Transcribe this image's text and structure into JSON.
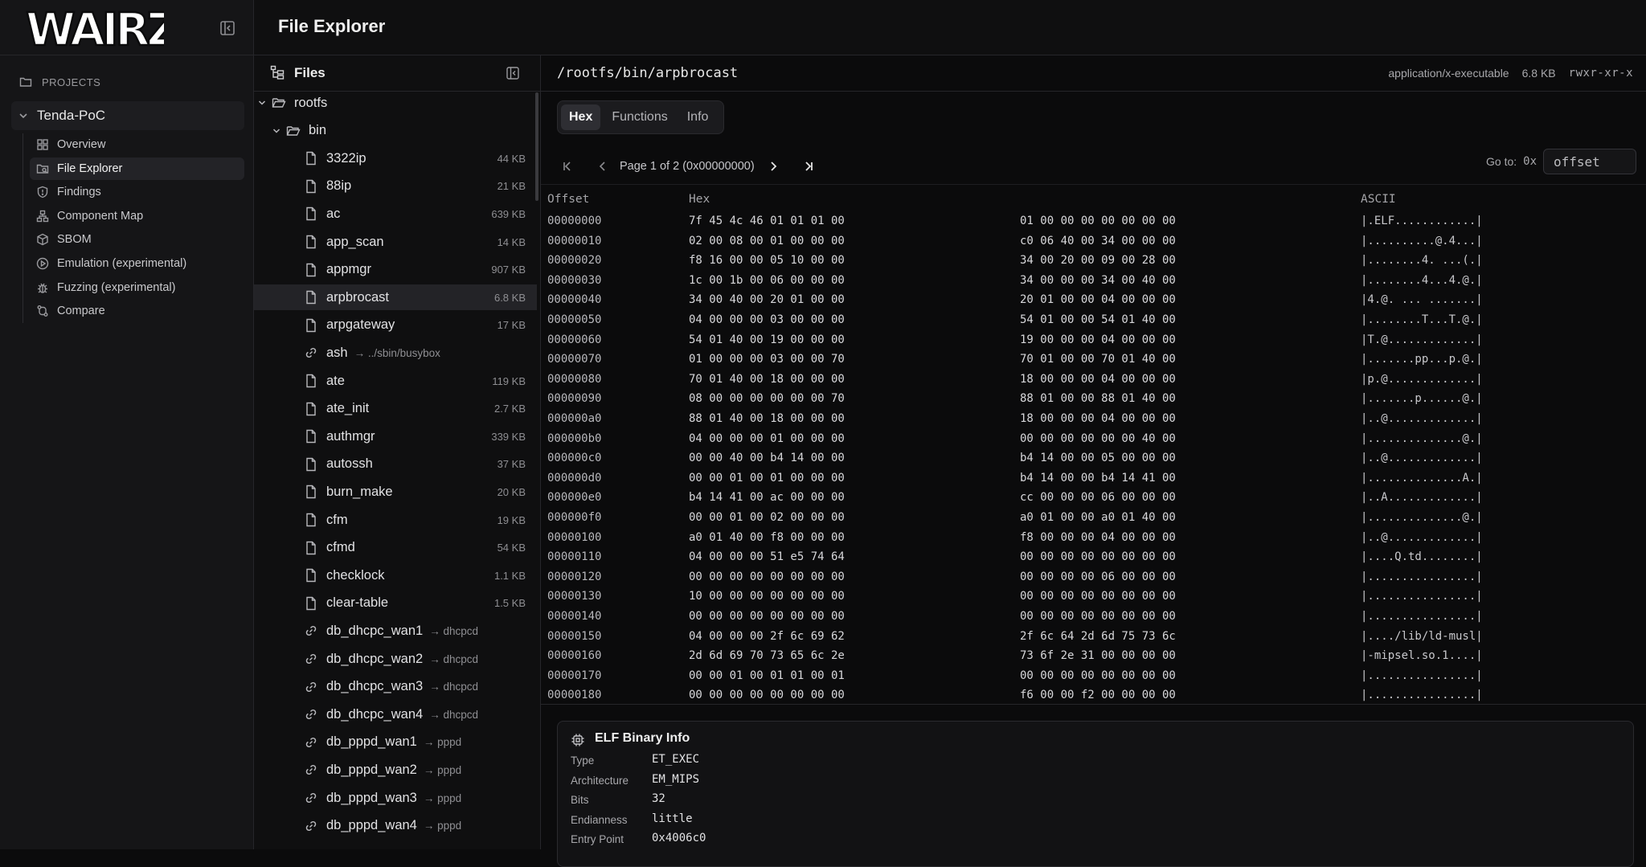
{
  "app": {
    "brand": "WAIRZ",
    "page_title": "File Explorer"
  },
  "sidebar": {
    "projects_label": "PROJECTS",
    "project_name": "Tenda-PoC",
    "items": [
      {
        "label": "Overview",
        "icon": "grid-icon"
      },
      {
        "label": "File Explorer",
        "icon": "folder-search-icon",
        "active": true
      },
      {
        "label": "Findings",
        "icon": "shield-icon"
      },
      {
        "label": "Component Map",
        "icon": "network-icon"
      },
      {
        "label": "SBOM",
        "icon": "package-icon"
      },
      {
        "label": "Emulation (experimental)",
        "icon": "play-circle-icon"
      },
      {
        "label": "Fuzzing (experimental)",
        "icon": "bug-icon"
      },
      {
        "label": "Compare",
        "icon": "compare-icon"
      }
    ]
  },
  "files_panel": {
    "title": "Files",
    "tree": [
      {
        "name": "rootfs",
        "type": "folder",
        "depth": 0
      },
      {
        "name": "bin",
        "type": "folder",
        "depth": 1
      },
      {
        "name": "3322ip",
        "type": "file",
        "size": "44 KB"
      },
      {
        "name": "88ip",
        "type": "file",
        "size": "21 KB"
      },
      {
        "name": "ac",
        "type": "file",
        "size": "639 KB"
      },
      {
        "name": "app_scan",
        "type": "file",
        "size": "14 KB"
      },
      {
        "name": "appmgr",
        "type": "file",
        "size": "907 KB"
      },
      {
        "name": "arpbrocast",
        "type": "file",
        "size": "6.8 KB",
        "selected": true
      },
      {
        "name": "arpgateway",
        "type": "file",
        "size": "17 KB"
      },
      {
        "name": "ash",
        "type": "link",
        "target": "../sbin/busybox"
      },
      {
        "name": "ate",
        "type": "file",
        "size": "119 KB"
      },
      {
        "name": "ate_init",
        "type": "file",
        "size": "2.7 KB"
      },
      {
        "name": "authmgr",
        "type": "file",
        "size": "339 KB"
      },
      {
        "name": "autossh",
        "type": "file",
        "size": "37 KB"
      },
      {
        "name": "burn_make",
        "type": "file",
        "size": "20 KB"
      },
      {
        "name": "cfm",
        "type": "file",
        "size": "19 KB"
      },
      {
        "name": "cfmd",
        "type": "file",
        "size": "54 KB"
      },
      {
        "name": "checklock",
        "type": "file",
        "size": "1.1 KB"
      },
      {
        "name": "clear-table",
        "type": "file",
        "size": "1.5 KB"
      },
      {
        "name": "db_dhcpc_wan1",
        "type": "link",
        "target": "dhcpcd"
      },
      {
        "name": "db_dhcpc_wan2",
        "type": "link",
        "target": "dhcpcd"
      },
      {
        "name": "db_dhcpc_wan3",
        "type": "link",
        "target": "dhcpcd"
      },
      {
        "name": "db_dhcpc_wan4",
        "type": "link",
        "target": "dhcpcd"
      },
      {
        "name": "db_pppd_wan1",
        "type": "link",
        "target": "pppd"
      },
      {
        "name": "db_pppd_wan2",
        "type": "link",
        "target": "pppd"
      },
      {
        "name": "db_pppd_wan3",
        "type": "link",
        "target": "pppd"
      },
      {
        "name": "db_pppd_wan4",
        "type": "link",
        "target": "pppd"
      }
    ]
  },
  "viewer": {
    "path": "/rootfs/bin/arpbrocast",
    "mime": "application/x-executable",
    "size": "6.8 KB",
    "permissions": "rwxr-xr-x",
    "tabs": [
      "Hex",
      "Functions",
      "Info"
    ],
    "active_tab": "Hex",
    "page_label": "Page 1 of 2 (0x00000000)",
    "goto_label": "Go to:",
    "goto_prefix": "0x",
    "goto_placeholder": "offset",
    "columns": {
      "offset": "Offset",
      "hex": "Hex",
      "ascii": "ASCII"
    },
    "rows": [
      {
        "offset": "00000000",
        "h1": "7f 45 4c 46 01 01 01 00",
        "h2": "01 00 00 00 00 00 00 00",
        "ascii": "|.ELF............|"
      },
      {
        "offset": "00000010",
        "h1": "02 00 08 00 01 00 00 00",
        "h2": "c0 06 40 00 34 00 00 00",
        "ascii": "|..........@.4...|"
      },
      {
        "offset": "00000020",
        "h1": "f8 16 00 00 05 10 00 00",
        "h2": "34 00 20 00 09 00 28 00",
        "ascii": "|........4. ...(.|"
      },
      {
        "offset": "00000030",
        "h1": "1c 00 1b 00 06 00 00 00",
        "h2": "34 00 00 00 34 00 40 00",
        "ascii": "|........4...4.@.|"
      },
      {
        "offset": "00000040",
        "h1": "34 00 40 00 20 01 00 00",
        "h2": "20 01 00 00 04 00 00 00",
        "ascii": "|4.@. ... .......|"
      },
      {
        "offset": "00000050",
        "h1": "04 00 00 00 03 00 00 00",
        "h2": "54 01 00 00 54 01 40 00",
        "ascii": "|........T...T.@.|"
      },
      {
        "offset": "00000060",
        "h1": "54 01 40 00 19 00 00 00",
        "h2": "19 00 00 00 04 00 00 00",
        "ascii": "|T.@.............|"
      },
      {
        "offset": "00000070",
        "h1": "01 00 00 00 03 00 00 70",
        "h2": "70 01 00 00 70 01 40 00",
        "ascii": "|.......pp...p.@.|"
      },
      {
        "offset": "00000080",
        "h1": "70 01 40 00 18 00 00 00",
        "h2": "18 00 00 00 04 00 00 00",
        "ascii": "|p.@.............|"
      },
      {
        "offset": "00000090",
        "h1": "08 00 00 00 00 00 00 70",
        "h2": "88 01 00 00 88 01 40 00",
        "ascii": "|.......p......@.|"
      },
      {
        "offset": "000000a0",
        "h1": "88 01 40 00 18 00 00 00",
        "h2": "18 00 00 00 04 00 00 00",
        "ascii": "|..@.............|"
      },
      {
        "offset": "000000b0",
        "h1": "04 00 00 00 01 00 00 00",
        "h2": "00 00 00 00 00 00 40 00",
        "ascii": "|..............@.|"
      },
      {
        "offset": "000000c0",
        "h1": "00 00 40 00 b4 14 00 00",
        "h2": "b4 14 00 00 05 00 00 00",
        "ascii": "|..@.............|"
      },
      {
        "offset": "000000d0",
        "h1": "00 00 01 00 01 00 00 00",
        "h2": "b4 14 00 00 b4 14 41 00",
        "ascii": "|..............A.|"
      },
      {
        "offset": "000000e0",
        "h1": "b4 14 41 00 ac 00 00 00",
        "h2": "cc 00 00 00 06 00 00 00",
        "ascii": "|..A.............|"
      },
      {
        "offset": "000000f0",
        "h1": "00 00 01 00 02 00 00 00",
        "h2": "a0 01 00 00 a0 01 40 00",
        "ascii": "|..............@.|"
      },
      {
        "offset": "00000100",
        "h1": "a0 01 40 00 f8 00 00 00",
        "h2": "f8 00 00 00 04 00 00 00",
        "ascii": "|..@.............|"
      },
      {
        "offset": "00000110",
        "h1": "04 00 00 00 51 e5 74 64",
        "h2": "00 00 00 00 00 00 00 00",
        "ascii": "|....Q.td........|"
      },
      {
        "offset": "00000120",
        "h1": "00 00 00 00 00 00 00 00",
        "h2": "00 00 00 00 06 00 00 00",
        "ascii": "|................|"
      },
      {
        "offset": "00000130",
        "h1": "10 00 00 00 00 00 00 00",
        "h2": "00 00 00 00 00 00 00 00",
        "ascii": "|................|"
      },
      {
        "offset": "00000140",
        "h1": "00 00 00 00 00 00 00 00",
        "h2": "00 00 00 00 00 00 00 00",
        "ascii": "|................|"
      },
      {
        "offset": "00000150",
        "h1": "04 00 00 00 2f 6c 69 62",
        "h2": "2f 6c 64 2d 6d 75 73 6c",
        "ascii": "|..../lib/ld-musl|"
      },
      {
        "offset": "00000160",
        "h1": "2d 6d 69 70 73 65 6c 2e",
        "h2": "73 6f 2e 31 00 00 00 00",
        "ascii": "|-mipsel.so.1....|"
      },
      {
        "offset": "00000170",
        "h1": "00 00 01 00 01 01 00 01",
        "h2": "00 00 00 00 00 00 00 00",
        "ascii": "|................|"
      },
      {
        "offset": "00000180",
        "h1": "00 00 00 00 00 00 00 00",
        "h2": "f6 00 00 f2 00 00 00 00",
        "ascii": "|................|"
      }
    ],
    "elf_info": {
      "title": "ELF Binary Info",
      "fields": [
        {
          "key": "Type",
          "value": "ET_EXEC"
        },
        {
          "key": "Architecture",
          "value": "EM_MIPS"
        },
        {
          "key": "Bits",
          "value": "32"
        },
        {
          "key": "Endianness",
          "value": "little"
        },
        {
          "key": "Entry Point",
          "value": "0x4006c0"
        }
      ]
    }
  }
}
